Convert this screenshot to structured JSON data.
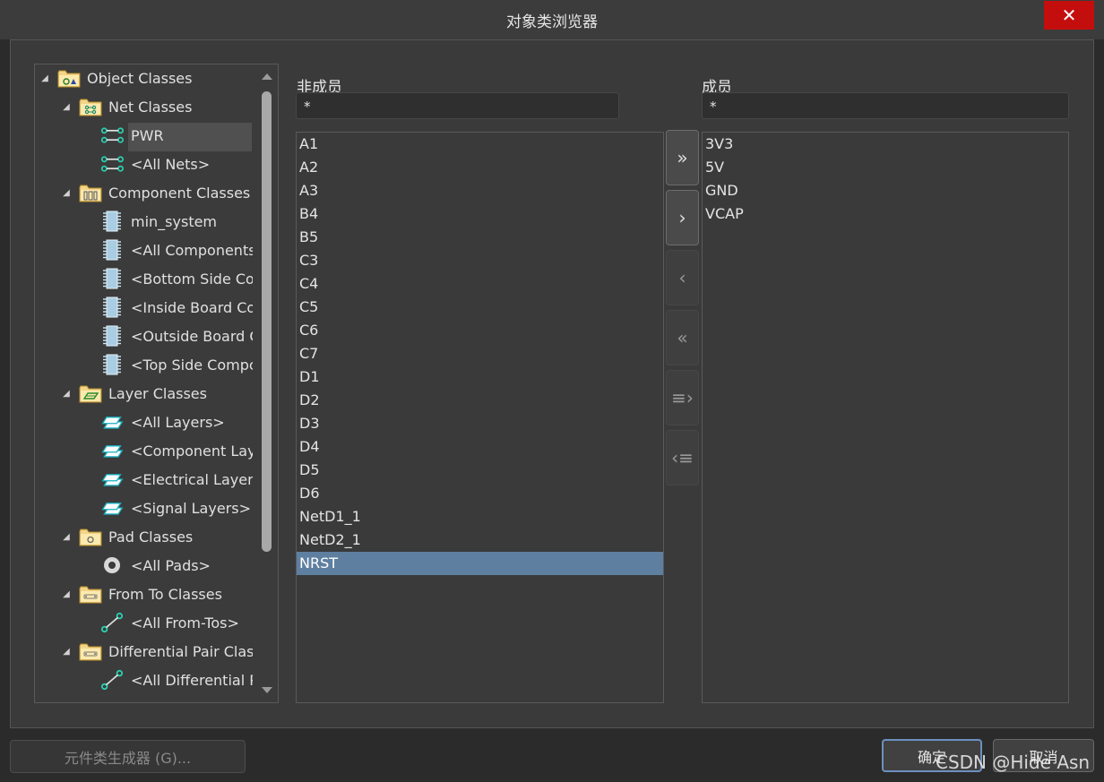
{
  "window": {
    "title": "对象类浏览器",
    "close_glyph": "✕"
  },
  "tree": {
    "items": [
      {
        "level": 0,
        "label": "Object Classes",
        "icon": "folder-object-classes-icon",
        "expanded": true
      },
      {
        "level": 1,
        "label": "Net Classes",
        "icon": "folder-net-classes-icon",
        "expanded": true
      },
      {
        "level": 2,
        "label": "PWR",
        "icon": "net-icon",
        "selected": true
      },
      {
        "level": 2,
        "label": "<All Nets>",
        "icon": "net-icon"
      },
      {
        "level": 1,
        "label": "Component Classes",
        "icon": "folder-component-classes-icon",
        "expanded": true
      },
      {
        "level": 2,
        "label": "min_system",
        "icon": "component-icon"
      },
      {
        "level": 2,
        "label": "<All Components",
        "icon": "component-icon"
      },
      {
        "level": 2,
        "label": "<Bottom Side Cor",
        "icon": "component-icon"
      },
      {
        "level": 2,
        "label": "<Inside Board Cor",
        "icon": "component-icon"
      },
      {
        "level": 2,
        "label": "<Outside Board C",
        "icon": "component-icon"
      },
      {
        "level": 2,
        "label": "<Top Side Compc",
        "icon": "component-icon"
      },
      {
        "level": 1,
        "label": "Layer Classes",
        "icon": "folder-layer-classes-icon",
        "expanded": true
      },
      {
        "level": 2,
        "label": "<All Layers>",
        "icon": "layer-icon"
      },
      {
        "level": 2,
        "label": "<Component Laye",
        "icon": "layer-icon"
      },
      {
        "level": 2,
        "label": "<Electrical Layers>",
        "icon": "layer-icon"
      },
      {
        "level": 2,
        "label": "<Signal Layers>",
        "icon": "layer-icon"
      },
      {
        "level": 1,
        "label": "Pad Classes",
        "icon": "folder-pad-classes-icon",
        "expanded": true
      },
      {
        "level": 2,
        "label": "<All Pads>",
        "icon": "pad-icon"
      },
      {
        "level": 1,
        "label": "From To Classes",
        "icon": "folder-from-to-classes-icon",
        "expanded": true
      },
      {
        "level": 2,
        "label": "<All From-Tos>",
        "icon": "from-to-icon"
      },
      {
        "level": 1,
        "label": "Differential Pair Class",
        "icon": "folder-diff-pair-classes-icon",
        "expanded": true
      },
      {
        "level": 2,
        "label": "<All Differential Pa",
        "icon": "from-to-icon"
      }
    ]
  },
  "non_members": {
    "label": "非成员",
    "filter_value": "*",
    "items": [
      "A1",
      "A2",
      "A3",
      "B4",
      "B5",
      "C3",
      "C4",
      "C5",
      "C6",
      "C7",
      "D1",
      "D2",
      "D3",
      "D4",
      "D5",
      "D6",
      "NetD1_1",
      "NetD2_1",
      "NRST"
    ],
    "selected": "NRST"
  },
  "members": {
    "label": "成员",
    "filter_value": "*",
    "items": [
      "3V3",
      "5V",
      "GND",
      "VCAP"
    ]
  },
  "move_buttons": [
    {
      "name": "add-all-button",
      "glyph": "»",
      "enabled": true
    },
    {
      "name": "add-selected-button",
      "glyph": "›",
      "enabled": true
    },
    {
      "name": "remove-selected-button",
      "glyph": "‹",
      "enabled": false
    },
    {
      "name": "remove-all-button",
      "glyph": "«",
      "enabled": false
    },
    {
      "name": "add-filtered-button",
      "glyph": "≡›",
      "enabled": false
    },
    {
      "name": "remove-filtered-button",
      "glyph": "‹≡",
      "enabled": false
    }
  ],
  "footer": {
    "generator_label": "元件类生成器 (G)...",
    "ok_label": "确定",
    "cancel_label": "取消"
  },
  "watermark": "CSDN @Hide Asn"
}
